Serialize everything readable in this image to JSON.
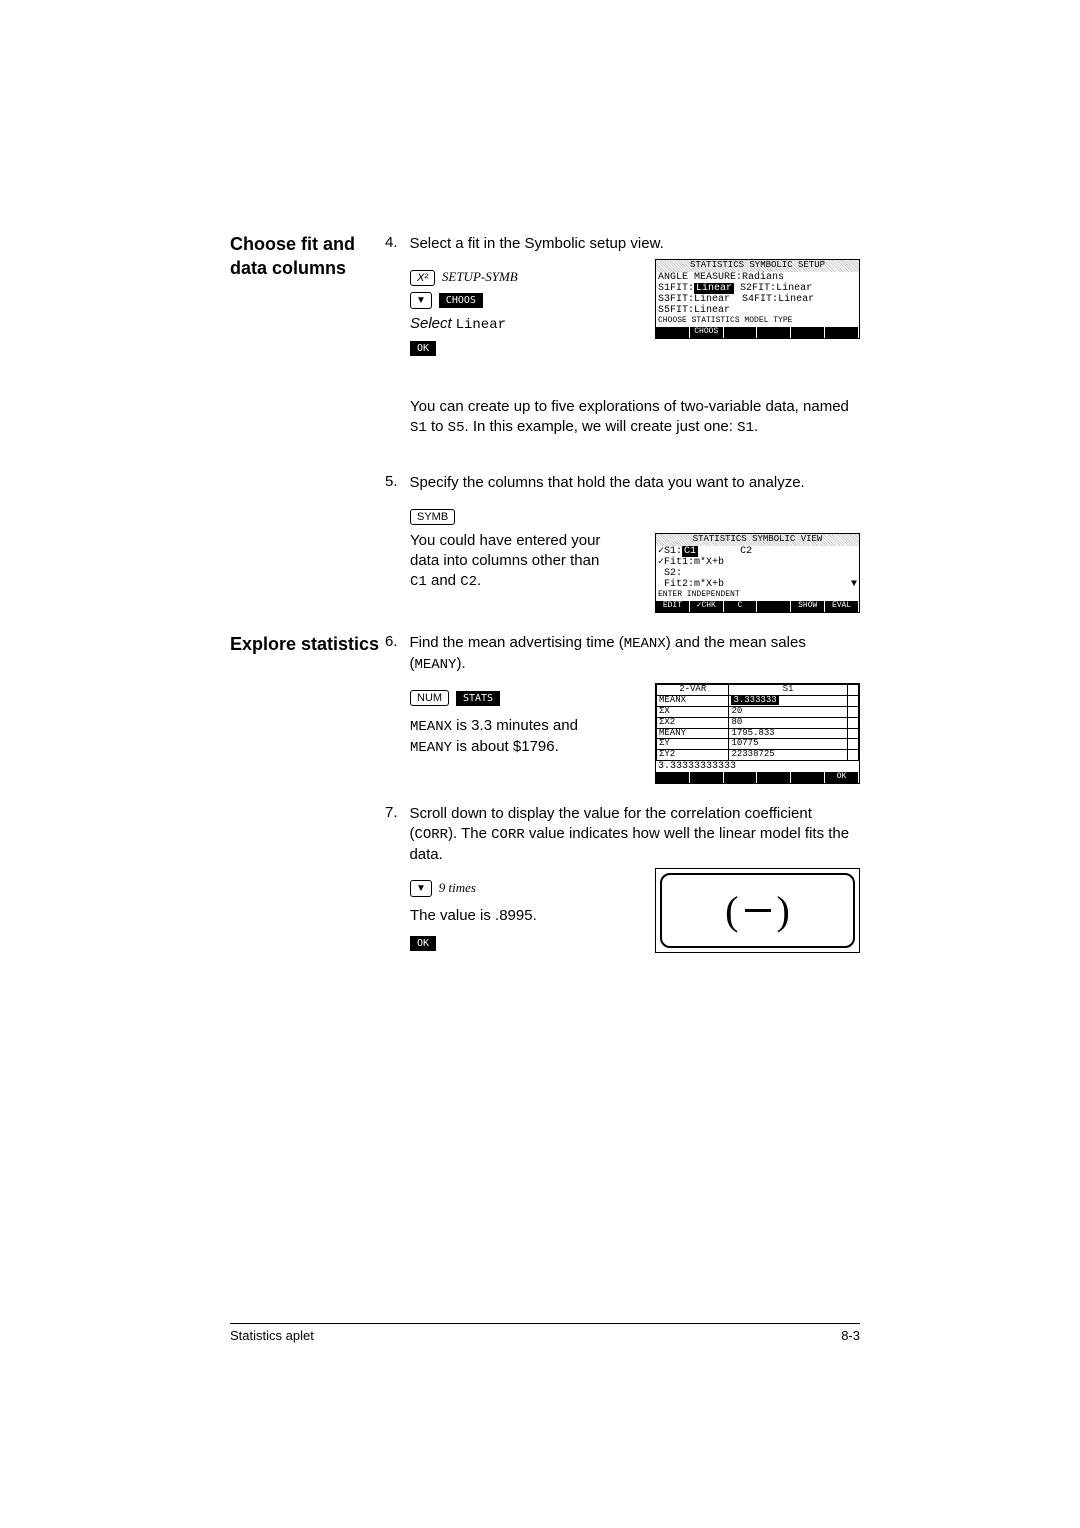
{
  "headings": {
    "h1": "Choose fit and data columns",
    "h2": "Explore statistics"
  },
  "steps": {
    "s4": {
      "num": "4.",
      "text": "Select a fit in the Symbolic setup view."
    },
    "s5": {
      "num": "5.",
      "text": "Specify the columns that hold the data you want to analyze."
    },
    "s6_num": "6.",
    "s6_a": "Find the mean advertising time (",
    "s6_b": ") and the mean sales (",
    "s6_c": ").",
    "s7_num": "7.",
    "s7_a": "Scroll down to display the value for the correlation coefficient (",
    "s7_b": "). The ",
    "s7_c": " value indicates how well the linear model fits the data."
  },
  "tokens": {
    "meanx": "MEANX",
    "meany": "MEANY",
    "corr": "CORR",
    "s1": "S1",
    "s5_end": "S5",
    "c1": "C1",
    "c2": "C2",
    "s1lower": "S1"
  },
  "para1_a": "You can create up to five explorations of two-variable data, named ",
  "para1_b": " to ",
  "para1_c": ". In this example, we will create just one: ",
  "para1_d": ".",
  "keys": {
    "x2": "X²",
    "setup_symb": "SETUP-SYMB",
    "choos": "CHOOS",
    "select_linear_label": "Select",
    "select_linear_value": "Linear",
    "ok": "OK",
    "symb": "SYMB",
    "num": "NUM",
    "stats": "STATS",
    "down": "▼",
    "ninetimes": "9 times"
  },
  "side5_a": "You could have entered your data into columns other than ",
  "side5_b": " and ",
  "side5_c": ".",
  "side6_a": " is 3.3 minutes and ",
  "side6_b": " is about $1796.",
  "side7": "The value is .8995.",
  "screen1": {
    "title": "STATISTICS SYMBOLIC SETUP",
    "row1a": "ANGLE MEASURE:",
    "row1b": "Radians",
    "r2a": "S1FIT:",
    "r2b": "Linear",
    "r2c": "S2FIT:",
    "r2d": "Linear",
    "r3a": "S3FIT:",
    "r3b": "Linear",
    "r3c": "S4FIT:",
    "r3d": "Linear",
    "r4a": "S5FIT:",
    "r4b": "Linear",
    "status": "CHOOSE STATISTICS MODEL TYPE",
    "foot": "CHOOS"
  },
  "screen2": {
    "title": "STATISTICS SYMBOLIC VIEW",
    "r1": "✓S1:",
    "r1b": "C1",
    "r1c": "C2",
    "r2": "✓Fit1:m*X+b",
    "r3": " S2:",
    "r4": " Fit2:m*X+b",
    "status": "ENTER INDEPENDENT",
    "f1": "EDIT",
    "f2": "✓CHK",
    "f3": "C",
    "f5": "SHOW",
    "f6": "EVAL"
  },
  "screen3": {
    "hdr1": "2-VAR",
    "hdr2": "S1",
    "rows": [
      [
        "MEANX",
        "3.333333"
      ],
      [
        "ΣX",
        "20"
      ],
      [
        "ΣX2",
        "80"
      ],
      [
        "MEANY",
        "1795.833"
      ],
      [
        "ΣY",
        "10775"
      ],
      [
        "ΣY2",
        "22338725"
      ]
    ],
    "bottom": "3.33333333333",
    "foot": "OK"
  },
  "footer": {
    "left": "Statistics aplet",
    "right": "8-3"
  }
}
